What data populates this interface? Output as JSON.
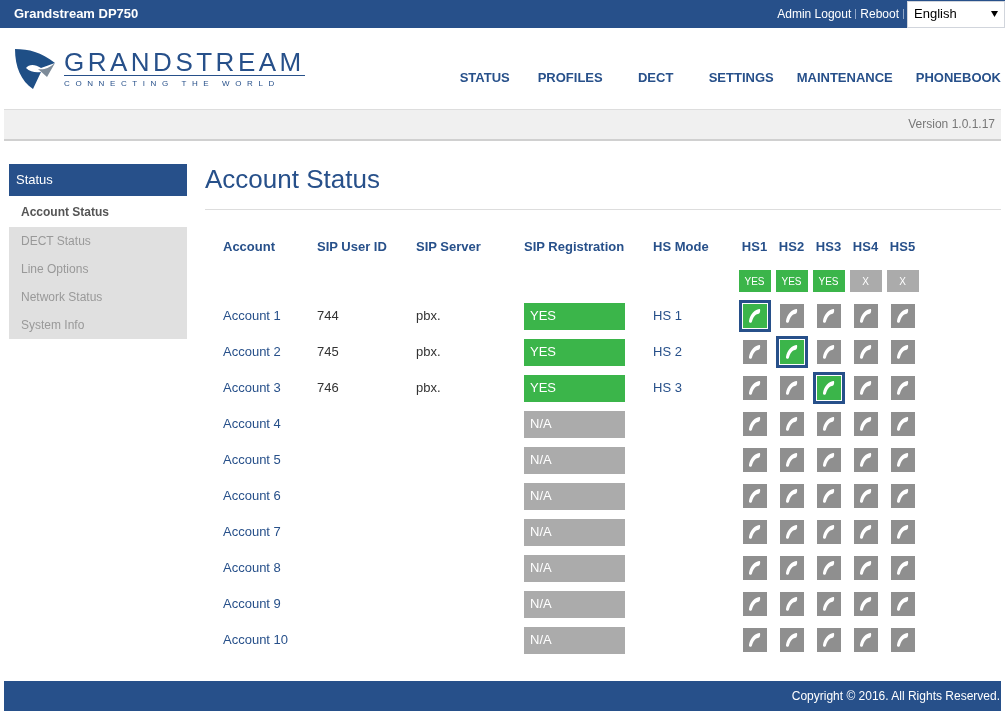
{
  "top_bar": {
    "title": "Grandstream DP750",
    "links": [
      "Admin Logout",
      "Reboot"
    ],
    "language": "English"
  },
  "logo": {
    "name": "GRANDSTREAM",
    "tagline": "CONNECTING THE WORLD"
  },
  "nav": [
    {
      "label": "STATUS"
    },
    {
      "label": "PROFILES"
    },
    {
      "label": "DECT"
    },
    {
      "label": "SETTINGS"
    },
    {
      "label": "MAINTENANCE"
    },
    {
      "label": "PHONEBOOK"
    }
  ],
  "version": "Version 1.0.1.17",
  "sidebar": {
    "section": "Status",
    "items": [
      {
        "label": "Account Status",
        "selected": true
      },
      {
        "label": "DECT Status",
        "selected": false
      },
      {
        "label": "Line Options",
        "selected": false
      },
      {
        "label": "Network Status",
        "selected": false
      },
      {
        "label": "System Info",
        "selected": false
      }
    ]
  },
  "page_title": "Account Status",
  "table": {
    "columns": [
      "Account",
      "SIP User ID",
      "SIP Server",
      "SIP Registration",
      "HS Mode"
    ],
    "handsets": [
      {
        "label": "HS1",
        "status": "YES",
        "registered": true
      },
      {
        "label": "HS2",
        "status": "YES",
        "registered": true
      },
      {
        "label": "HS3",
        "status": "YES",
        "registered": true
      },
      {
        "label": "HS4",
        "status": "X",
        "registered": false
      },
      {
        "label": "HS5",
        "status": "X",
        "registered": false
      }
    ],
    "rows": [
      {
        "account": "Account 1",
        "sip_user_id": "744",
        "sip_server": "pbx.",
        "registration": "YES",
        "registered": true,
        "hs_mode": "HS 1",
        "handsets": [
          {
            "selected": true
          },
          {
            "selected": false
          },
          {
            "selected": false
          },
          {
            "selected": false
          },
          {
            "selected": false
          }
        ]
      },
      {
        "account": "Account 2",
        "sip_user_id": "745",
        "sip_server": "pbx.",
        "registration": "YES",
        "registered": true,
        "hs_mode": "HS 2",
        "handsets": [
          {
            "selected": false
          },
          {
            "selected": true
          },
          {
            "selected": false
          },
          {
            "selected": false
          },
          {
            "selected": false
          }
        ]
      },
      {
        "account": "Account 3",
        "sip_user_id": "746",
        "sip_server": "pbx.",
        "registration": "YES",
        "registered": true,
        "hs_mode": "HS 3",
        "handsets": [
          {
            "selected": false
          },
          {
            "selected": false
          },
          {
            "selected": true
          },
          {
            "selected": false
          },
          {
            "selected": false
          }
        ]
      },
      {
        "account": "Account 4",
        "registration": "N/A",
        "registered": false,
        "handsets": [
          {
            "selected": false
          },
          {
            "selected": false
          },
          {
            "selected": false
          },
          {
            "selected": false
          },
          {
            "selected": false
          }
        ]
      },
      {
        "account": "Account 5",
        "registration": "N/A",
        "registered": false,
        "handsets": [
          {
            "selected": false
          },
          {
            "selected": false
          },
          {
            "selected": false
          },
          {
            "selected": false
          },
          {
            "selected": false
          }
        ]
      },
      {
        "account": "Account 6",
        "registration": "N/A",
        "registered": false,
        "handsets": [
          {
            "selected": false
          },
          {
            "selected": false
          },
          {
            "selected": false
          },
          {
            "selected": false
          },
          {
            "selected": false
          }
        ]
      },
      {
        "account": "Account 7",
        "registration": "N/A",
        "registered": false,
        "handsets": [
          {
            "selected": false
          },
          {
            "selected": false
          },
          {
            "selected": false
          },
          {
            "selected": false
          },
          {
            "selected": false
          }
        ]
      },
      {
        "account": "Account 8",
        "registration": "N/A",
        "registered": false,
        "handsets": [
          {
            "selected": false
          },
          {
            "selected": false
          },
          {
            "selected": false
          },
          {
            "selected": false
          },
          {
            "selected": false
          }
        ]
      },
      {
        "account": "Account 9",
        "registration": "N/A",
        "registered": false,
        "handsets": [
          {
            "selected": false
          },
          {
            "selected": false
          },
          {
            "selected": false
          },
          {
            "selected": false
          },
          {
            "selected": false
          }
        ]
      },
      {
        "account": "Account 10",
        "registration": "N/A",
        "registered": false,
        "handsets": [
          {
            "selected": false
          },
          {
            "selected": false
          },
          {
            "selected": false
          },
          {
            "selected": false
          },
          {
            "selected": false
          }
        ]
      }
    ]
  },
  "footer": "Copyright © 2016. All Rights Reserved."
}
